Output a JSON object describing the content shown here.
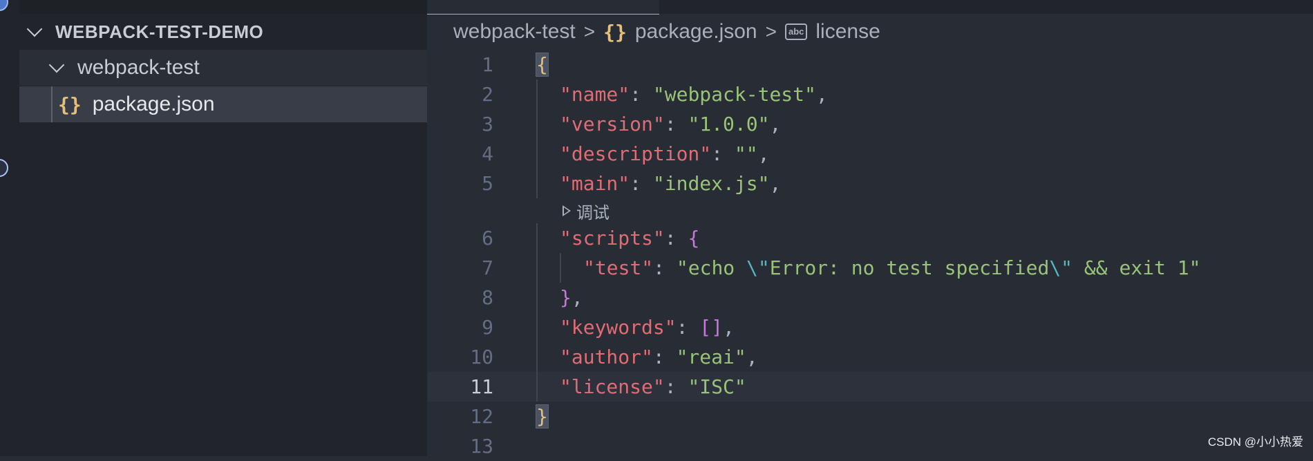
{
  "explorer": {
    "root_label": "WEBPACK-TEST-DEMO",
    "folder_label": "webpack-test",
    "file_label": "package.json",
    "file_icon": "{}"
  },
  "breadcrumb": {
    "segments": [
      "webpack-test",
      "package.json",
      "license"
    ],
    "json_icon": "{}",
    "abc_icon": "abc",
    "separator": ">"
  },
  "editor": {
    "current_line": 11,
    "code_lens": "调试",
    "line_numbers": [
      "1",
      "2",
      "3",
      "4",
      "5",
      "6",
      "7",
      "8",
      "9",
      "10",
      "11",
      "12",
      "13"
    ],
    "lines": [
      {
        "n": "1",
        "tokens": [
          {
            "t": "{",
            "c": "y"
          }
        ]
      },
      {
        "n": "2",
        "tokens": [
          {
            "t": "\"name\"",
            "c": "k"
          },
          {
            "t": ": ",
            "c": "p"
          },
          {
            "t": "\"webpack-test\"",
            "c": "s"
          },
          {
            "t": ",",
            "c": "p"
          }
        ]
      },
      {
        "n": "3",
        "tokens": [
          {
            "t": "\"version\"",
            "c": "k"
          },
          {
            "t": ": ",
            "c": "p"
          },
          {
            "t": "\"1.0.0\"",
            "c": "s"
          },
          {
            "t": ",",
            "c": "p"
          }
        ]
      },
      {
        "n": "4",
        "tokens": [
          {
            "t": "\"description\"",
            "c": "k"
          },
          {
            "t": ": ",
            "c": "p"
          },
          {
            "t": "\"\"",
            "c": "s"
          },
          {
            "t": ",",
            "c": "p"
          }
        ]
      },
      {
        "n": "5",
        "tokens": [
          {
            "t": "\"main\"",
            "c": "k"
          },
          {
            "t": ": ",
            "c": "p"
          },
          {
            "t": "\"index.js\"",
            "c": "s"
          },
          {
            "t": ",",
            "c": "p"
          }
        ]
      },
      {
        "n": "6",
        "tokens": [
          {
            "t": "\"scripts\"",
            "c": "k"
          },
          {
            "t": ": ",
            "c": "p"
          },
          {
            "t": "{",
            "c": "b"
          }
        ]
      },
      {
        "n": "7",
        "tokens": [
          {
            "t": "\"test\"",
            "c": "k"
          },
          {
            "t": ": ",
            "c": "p"
          },
          {
            "t": "\"echo ",
            "c": "s"
          },
          {
            "t": "\\\"",
            "c": "esc"
          },
          {
            "t": "Error: no test specified",
            "c": "s"
          },
          {
            "t": "\\\"",
            "c": "esc"
          },
          {
            "t": " && exit 1\"",
            "c": "s"
          }
        ]
      },
      {
        "n": "8",
        "tokens": [
          {
            "t": "}",
            "c": "b"
          },
          {
            "t": ",",
            "c": "p"
          }
        ]
      },
      {
        "n": "9",
        "tokens": [
          {
            "t": "\"keywords\"",
            "c": "k"
          },
          {
            "t": ": ",
            "c": "p"
          },
          {
            "t": "[]",
            "c": "b"
          },
          {
            "t": ",",
            "c": "p"
          }
        ]
      },
      {
        "n": "10",
        "tokens": [
          {
            "t": "\"author\"",
            "c": "k"
          },
          {
            "t": ": ",
            "c": "p"
          },
          {
            "t": "\"reai\"",
            "c": "s"
          },
          {
            "t": ",",
            "c": "p"
          }
        ]
      },
      {
        "n": "11",
        "tokens": [
          {
            "t": "\"license\"",
            "c": "k"
          },
          {
            "t": ": ",
            "c": "p"
          },
          {
            "t": "\"ISC\"",
            "c": "s"
          }
        ]
      },
      {
        "n": "12",
        "tokens": [
          {
            "t": "}",
            "c": "y"
          }
        ]
      },
      {
        "n": "13",
        "tokens": []
      }
    ]
  },
  "watermark": "CSDN @小小热爱",
  "colors": {
    "key": "#e06c75",
    "string": "#98c379",
    "brace": "#e5c07b",
    "bracket": "#c678dd",
    "escape": "#56b6c2",
    "sidebar_bg": "#21252b",
    "editor_bg": "#282c34"
  }
}
